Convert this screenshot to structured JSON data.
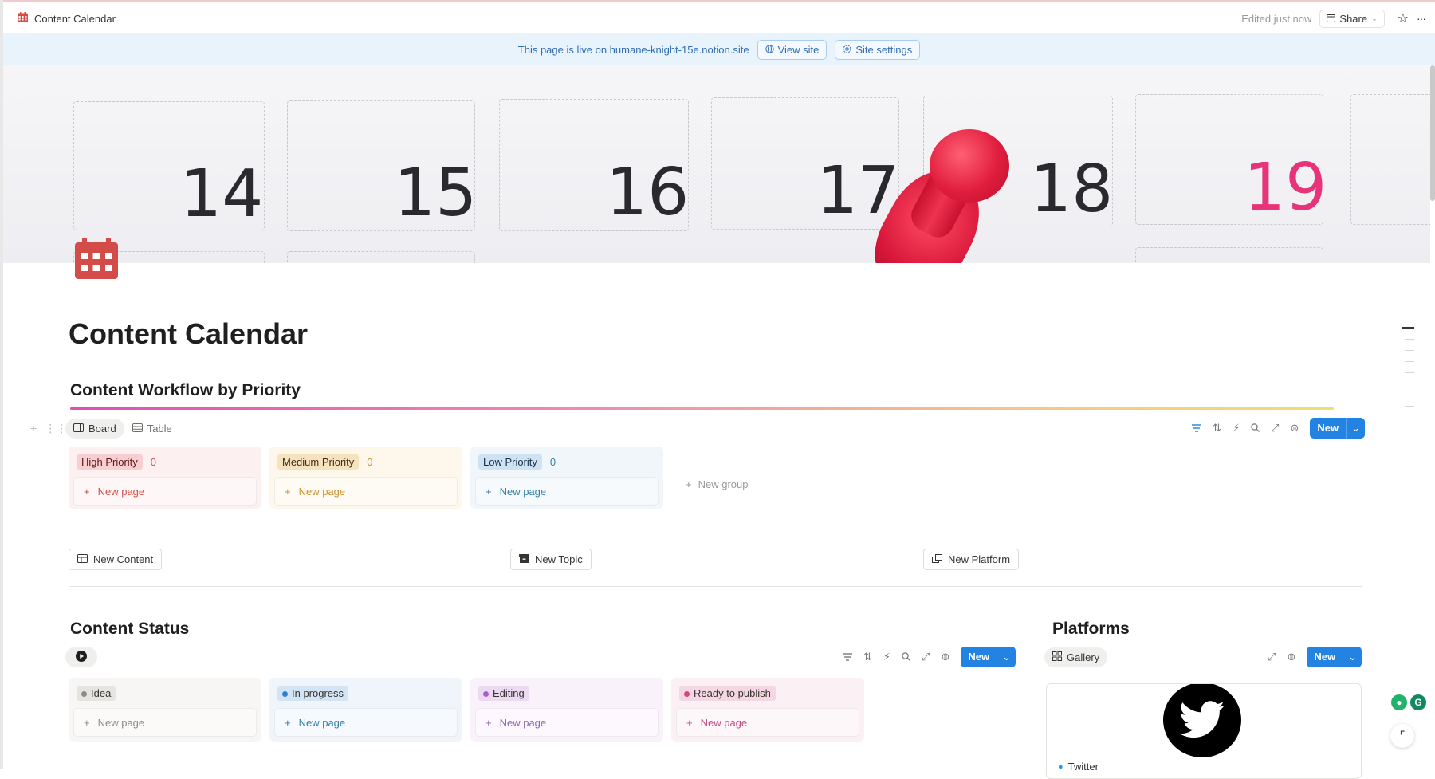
{
  "topbar": {
    "page_title": "Content Calendar",
    "edited": "Edited just now",
    "share_label": "Share",
    "more_label": "···"
  },
  "banner": {
    "message": "This page is live on humane-knight-15e.notion.site",
    "view_site": "View site",
    "site_settings": "Site settings"
  },
  "cover": {
    "dates": [
      "14",
      "15",
      "16",
      "17",
      "18",
      "19"
    ],
    "accent_date_color": "#e8337a"
  },
  "page": {
    "title": "Content Calendar"
  },
  "workflow": {
    "heading": "Content Workflow by Priority",
    "tabs": [
      {
        "label": "Board"
      },
      {
        "label": "Table"
      }
    ],
    "new_label": "New",
    "groups": [
      {
        "name": "High Priority",
        "count": "0",
        "new_page": "New page",
        "bg": "#fdf0f1",
        "tag_bg": "#f7cfd3",
        "tag_color": "#5d1715",
        "accent": "#d44c47"
      },
      {
        "name": "Medium Priority",
        "count": "0",
        "new_page": "New page",
        "bg": "#fdf7ec",
        "tag_bg": "#f6e3bd",
        "tag_color": "#402c1b",
        "accent": "#cb912f"
      },
      {
        "name": "Low Priority",
        "count": "0",
        "new_page": "New page",
        "bg": "#f1f6fb",
        "tag_bg": "#cfe2f3",
        "tag_color": "#183347",
        "accent": "#337ea9"
      }
    ],
    "new_group": "New group"
  },
  "quick_buttons": {
    "new_content": "New Content",
    "new_topic": "New Topic",
    "new_platform": "New Platform"
  },
  "content_status": {
    "heading": "Content Status",
    "new_label": "New",
    "groups": [
      {
        "name": "Idea",
        "new_page": "New page",
        "bg": "#f8f6f5",
        "tag_bg": "#e6e4e1",
        "dot": "#8c8b87",
        "accent": "#8c8b87"
      },
      {
        "name": "In progress",
        "new_page": "New page",
        "bg": "#eff5fb",
        "tag_bg": "#d3e5f4",
        "dot": "#2f7fd0",
        "accent": "#337ea9"
      },
      {
        "name": "Editing",
        "new_page": "New page",
        "bg": "#f9f2fb",
        "tag_bg": "#ecd9f2",
        "dot": "#a660c7",
        "accent": "#9065b0"
      },
      {
        "name": "Ready to publish",
        "new_page": "New page",
        "bg": "#fbf1f5",
        "tag_bg": "#f5d6e3",
        "dot": "#d4447f",
        "accent": "#c14c8a"
      }
    ]
  },
  "platforms": {
    "heading": "Platforms",
    "view_label": "Gallery",
    "new_label": "New",
    "cards": [
      {
        "name": "Twitter"
      }
    ]
  }
}
